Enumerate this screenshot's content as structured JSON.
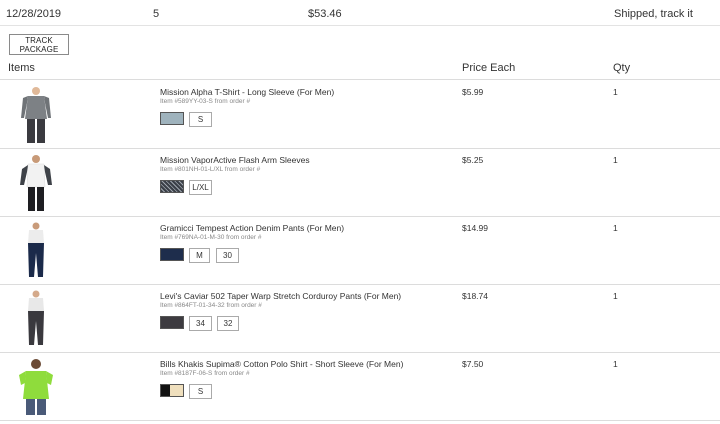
{
  "order": {
    "date": "12/28/2019",
    "item_count": "5",
    "total": "$53.46",
    "status": "Shipped, track it"
  },
  "track_button": {
    "label": "TRACK PACKAGE"
  },
  "table_header": {
    "items": "Items",
    "price": "Price Each",
    "qty": "Qty"
  },
  "items": [
    {
      "name": "Mission Alpha T-Shirt - Long Sleeve (For Men)",
      "sub": "Item #589YY-03-S from order #",
      "swatch_color": "#9fb3bd",
      "options": [
        "S"
      ],
      "price": "$5.99",
      "qty": "1"
    },
    {
      "name": "Mission VaporActive Flash Arm Sleeves",
      "sub": "Item #801NH-01-L/XL from order #",
      "swatch_color": "#4a4f57",
      "options": [
        "L/XL"
      ],
      "price": "$5.25",
      "qty": "1"
    },
    {
      "name": "Gramicci Tempest Action Denim Pants (For Men)",
      "sub": "Item #769NA-01-M-30 from order #",
      "swatch_color": "#1e2d4c",
      "options": [
        "M",
        "30"
      ],
      "price": "$14.99",
      "qty": "1"
    },
    {
      "name": "Levi's Caviar 502 Taper Warp Stretch Corduroy Pants (For Men)",
      "sub": "Item #864FT-01-34-32 from order #",
      "swatch_color": "#3d3b40",
      "options": [
        "34",
        "32"
      ],
      "price": "$18.74",
      "qty": "1"
    },
    {
      "name": "Bills Khakis Supima® Cotton Polo Shirt - Short Sleeve (For Men)",
      "sub": "Item #8187F-06-S from order #",
      "swatch_color": "#efdfbd",
      "options": [
        "S"
      ],
      "price": "$7.50",
      "qty": "1"
    }
  ]
}
